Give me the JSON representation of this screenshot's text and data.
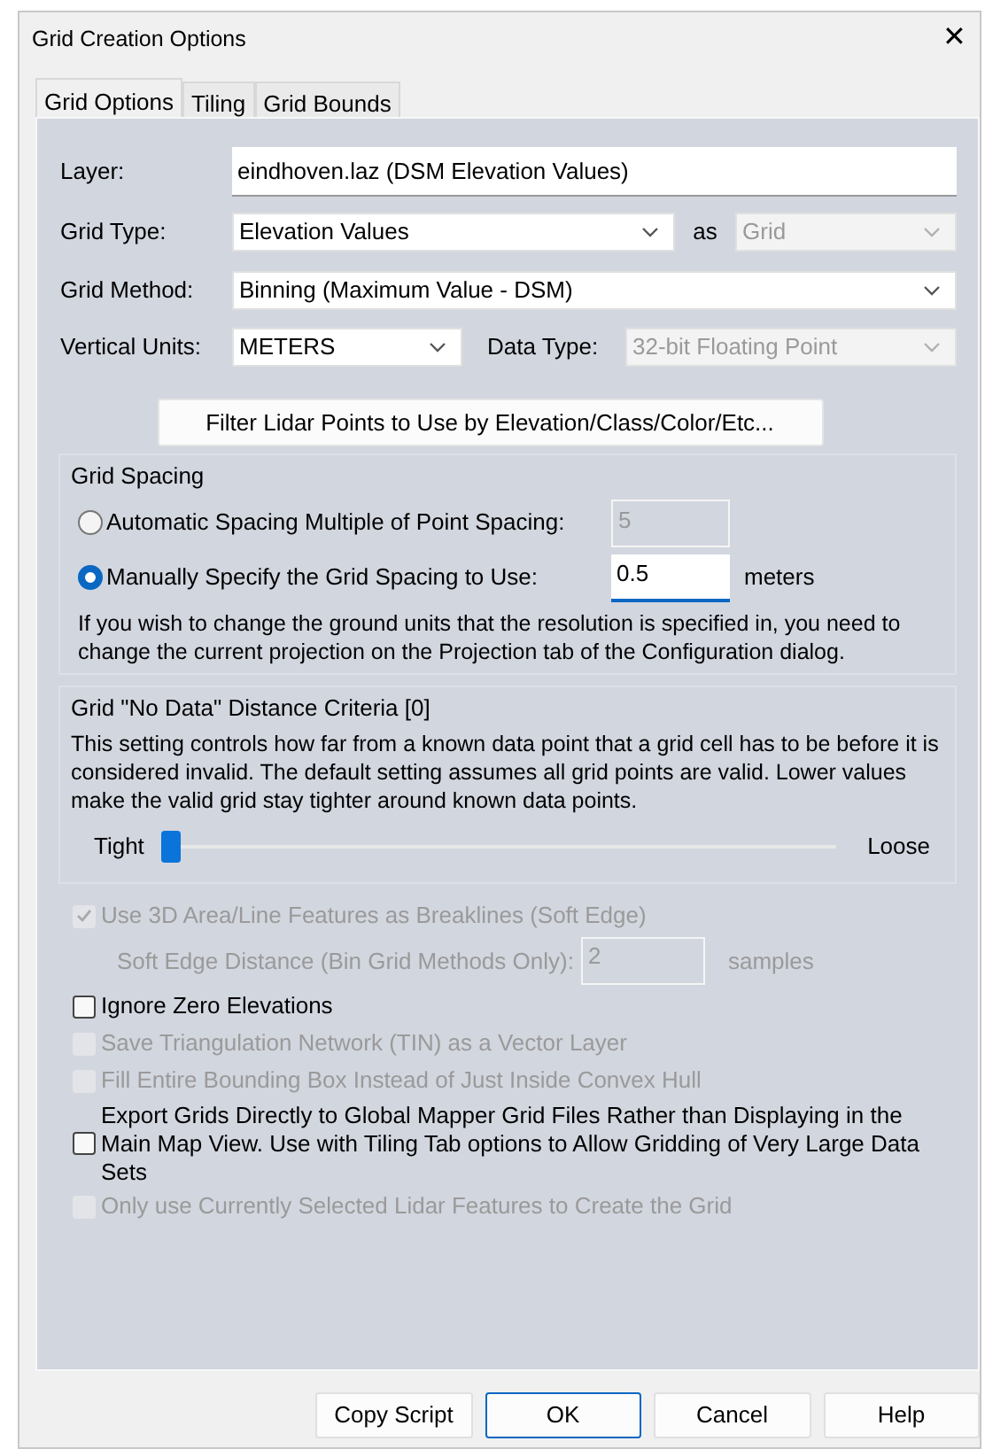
{
  "window": {
    "title": "Grid Creation Options",
    "close": "✕"
  },
  "tabs": [
    {
      "label": "Grid Options",
      "selected": true
    },
    {
      "label": "Tiling",
      "selected": false
    },
    {
      "label": "Grid Bounds",
      "selected": false
    }
  ],
  "layer": {
    "label": "Layer:",
    "value": "eindhoven.laz (DSM Elevation Values)"
  },
  "grid_type": {
    "label": "Grid Type:",
    "value": "Elevation Values",
    "as_label": "as",
    "as_value": "Grid",
    "as_disabled": true
  },
  "grid_method": {
    "label": "Grid Method:",
    "value": "Binning (Maximum Value - DSM)"
  },
  "vertical_units": {
    "label": "Vertical Units:",
    "value": "METERS",
    "data_type_label": "Data Type:",
    "data_type_value": "32-bit Floating Point",
    "data_type_disabled": true
  },
  "filter_button": "Filter Lidar Points to Use by Elevation/Class/Color/Etc...",
  "grid_spacing": {
    "title": "Grid Spacing",
    "options": [
      {
        "label": "Automatic Spacing Multiple of Point Spacing:",
        "selected": false,
        "value": "5"
      },
      {
        "label": "Manually Specify the Grid Spacing to Use:",
        "selected": true,
        "value": "0.5",
        "unit": "meters"
      }
    ],
    "note": "If you wish to change the ground units that the resolution is specified in, you need to change the current projection on the Projection tab of the Configuration dialog."
  },
  "no_data": {
    "title": "Grid \"No Data\" Distance Criteria [0]",
    "description": "This setting controls how far from a known data point that a grid cell has to be before it is considered invalid. The default setting assumes all grid points are valid. Lower values make the valid grid stay tighter around known data points.",
    "min_label": "Tight",
    "max_label": "Loose",
    "level": 0
  },
  "options": [
    {
      "kind": "checkbox",
      "label": "Use 3D Area/Line Features as Breaklines (Soft Edge)",
      "checked": true,
      "disabled": true
    },
    {
      "kind": "subfield",
      "label": "Soft Edge Distance (Bin Grid Methods Only):",
      "value": "2",
      "unit": "samples",
      "disabled": true
    },
    {
      "kind": "checkbox",
      "label": "Ignore Zero Elevations",
      "checked": false,
      "disabled": false
    },
    {
      "kind": "checkbox",
      "label": "Save Triangulation Network (TIN) as a Vector Layer",
      "checked": false,
      "disabled": true
    },
    {
      "kind": "checkbox",
      "label": "Fill Entire Bounding Box Instead of Just Inside Convex Hull",
      "checked": false,
      "disabled": true
    },
    {
      "kind": "checkbox",
      "label": "Export Grids Directly to Global Mapper Grid Files Rather than Displaying in the Main Map View. Use with Tiling Tab options to Allow Gridding of Very Large Data Sets",
      "checked": false,
      "disabled": false
    },
    {
      "kind": "checkbox",
      "label": "Only use Currently Selected Lidar Features to Create the Grid",
      "checked": false,
      "disabled": true
    }
  ],
  "buttons": [
    {
      "label": "Copy Script",
      "selected": false
    },
    {
      "label": "OK",
      "selected": true
    },
    {
      "label": "Cancel",
      "selected": false
    },
    {
      "label": "Help",
      "selected": false
    }
  ]
}
